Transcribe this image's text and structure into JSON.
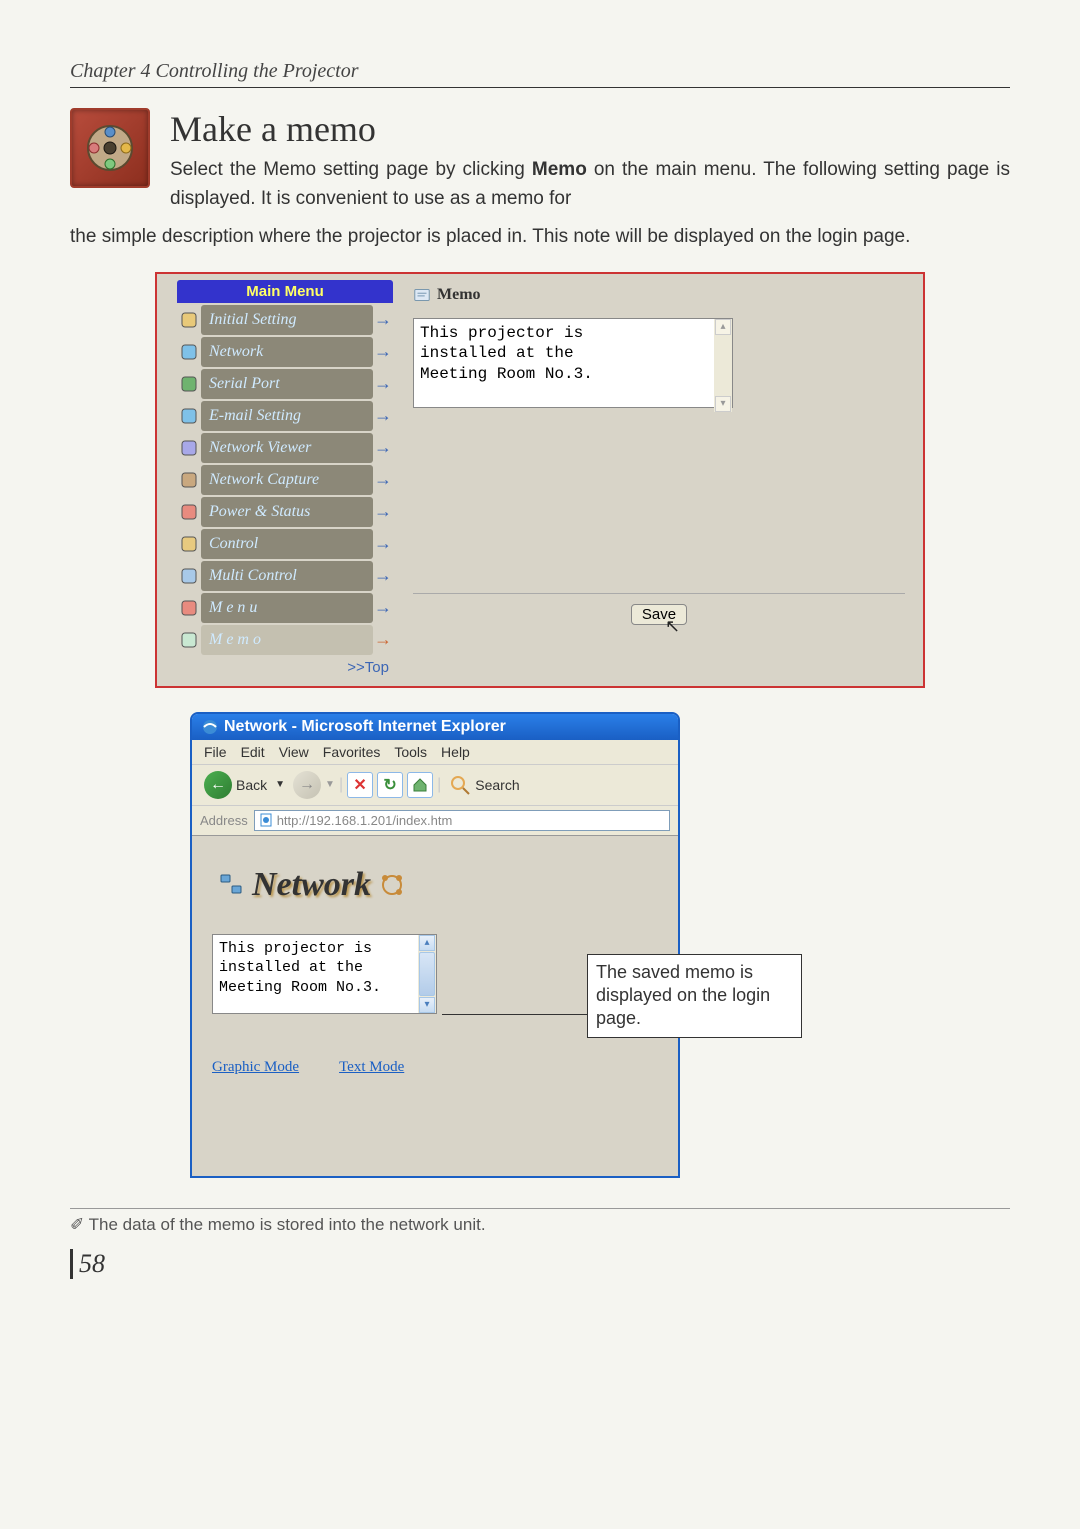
{
  "chapter_header": "Chapter 4 Controlling the Projector",
  "section_title": "Make a memo",
  "intro_part1": "Select the Memo setting page by clicking ",
  "intro_strong": "Memo",
  "intro_part2": " on the main menu. The following setting page is displayed. It is convenient to use as a memo for the simple description where the projector is placed in. This note will be displayed on the login page.",
  "main_menu": {
    "title": "Main Menu",
    "items": [
      {
        "label": "Initial Setting",
        "icon": "page-icon"
      },
      {
        "label": "Network",
        "icon": "network-icon"
      },
      {
        "label": "Serial Port",
        "icon": "port-icon"
      },
      {
        "label": "E-mail Setting",
        "icon": "mail-icon"
      },
      {
        "label": "Network Viewer",
        "icon": "viewer-icon"
      },
      {
        "label": "Network Capture",
        "icon": "capture-icon"
      },
      {
        "label": "Power & Status",
        "icon": "power-icon"
      },
      {
        "label": "Control",
        "icon": "control-icon"
      },
      {
        "label": "Multi Control",
        "icon": "multi-icon"
      },
      {
        "label": "M e n u",
        "icon": "menu-icon"
      },
      {
        "label": "M e m o",
        "icon": "memo-icon",
        "active": true
      }
    ],
    "top_link": ">>Top"
  },
  "content": {
    "title": "Memo",
    "memo_text": "This projector is\ninstalled at the\nMeeting Room No.3.",
    "save_label": "Save"
  },
  "ie_window": {
    "title": "Network - Microsoft Internet Explorer",
    "menu": [
      "File",
      "Edit",
      "View",
      "Favorites",
      "Tools",
      "Help"
    ],
    "toolbar": {
      "back": "Back",
      "search": "Search"
    },
    "address_label": "Address",
    "address_value": "http://192.168.1.201/index.htm",
    "logo": "Network",
    "login_memo": "This projector is\ninstalled at the\nMeeting Room No.3.",
    "mode_links": [
      "Graphic Mode",
      "Text Mode"
    ]
  },
  "callout": "The saved memo is displayed on the login page.",
  "footnote": "✐ The data of the memo is stored into the network unit.",
  "page_number": "58"
}
